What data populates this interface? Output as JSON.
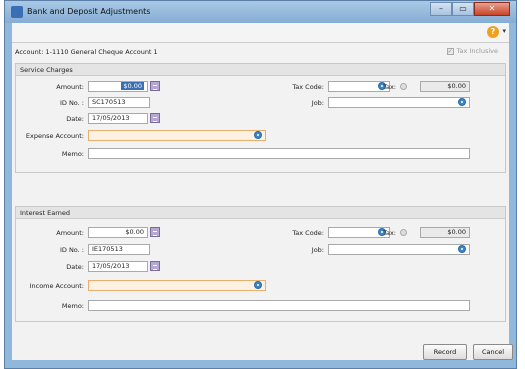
{
  "window": {
    "title": "Bank and Deposit Adjustments",
    "minimize_glyph": "–",
    "maximize_glyph": "▭",
    "close_glyph": "✕"
  },
  "toolbar": {
    "help_glyph": "?",
    "help_arrow": "▾"
  },
  "account": {
    "text": "Account:  1-1110 General Cheque Account 1",
    "tax_inclusive_label": "Tax Inclusive",
    "tax_inclusive_checked": true
  },
  "service": {
    "heading": "Service Charges",
    "amount_label": "Amount:",
    "amount_value": "$0.00",
    "id_label": "ID No. :",
    "id_value": "SC170513",
    "date_label": "Date:",
    "date_value": "17/05/2013",
    "account_label": "Expense Account:",
    "account_value": "",
    "memo_label": "Memo:",
    "memo_value": "",
    "tax_code_label": "Tax Code:",
    "tax_code_value": "",
    "tax_label": "Tax:",
    "tax_value": "$0.00",
    "job_label": "Job:",
    "job_value": ""
  },
  "interest": {
    "heading": "Interest Earned",
    "amount_label": "Amount:",
    "amount_value": "$0.00",
    "id_label": "ID No. :",
    "id_value": "IE170513",
    "date_label": "Date:",
    "date_value": "17/05/2013",
    "account_label": "Income Account:",
    "account_value": "",
    "memo_label": "Memo:",
    "memo_value": "",
    "tax_code_label": "Tax Code:",
    "tax_code_value": "",
    "tax_label": "Tax:",
    "tax_value": "$0.00",
    "job_label": "Job:",
    "job_value": ""
  },
  "buttons": {
    "record": "Record",
    "cancel": "Cancel"
  }
}
